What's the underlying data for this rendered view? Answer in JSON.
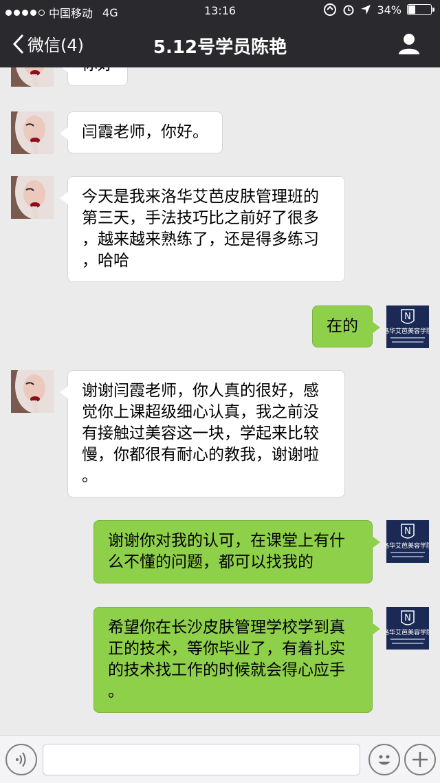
{
  "status_bar": {
    "carrier": "中国移动",
    "network": "4G",
    "time": "13:16",
    "battery": "34%",
    "battery_fraction": 0.34
  },
  "nav": {
    "back_label": "微信(4)",
    "title": "5.12号学员陈艳"
  },
  "messages": [
    {
      "side": "in",
      "text": "你好"
    },
    {
      "side": "in",
      "text": "闫霞老师，你好。"
    },
    {
      "side": "in",
      "lines": [
        "今天是我来洛华艾芭皮肤管理班的",
        "第三天，手法技巧比之前好了很多",
        "，越来越来熟练了，还是得多练习",
        "，哈哈"
      ]
    },
    {
      "side": "out",
      "text": "在的"
    },
    {
      "side": "in",
      "lines": [
        "谢谢闫霞老师，你人真的很好，感",
        "觉你上课超级细心认真，我之前没",
        "有接触过美容这一块，学起来比较",
        "慢，你都很有耐心的教我，谢谢啦",
        "。"
      ]
    },
    {
      "side": "out",
      "lines": [
        "谢谢你对我的认可，在课堂上有什",
        "么不懂的问题，都可以找我的"
      ]
    },
    {
      "side": "out",
      "lines": [
        "希望你在长沙皮肤管理学校学到真",
        "正的技术，等你毕业了，有着扎实",
        "的技术找工作的时候就会得心应手",
        "。"
      ]
    }
  ],
  "logo": {
    "letter": "N",
    "name": "洛华艾芭美容学院"
  },
  "colors": {
    "header_bg": "#2a2a2e",
    "chat_bg": "#ebebeb",
    "bubble_out": "#8fd04b",
    "bubble_in": "#ffffff"
  },
  "icons": [
    "voice-icon",
    "emoji-icon",
    "plus-icon",
    "person-icon",
    "back-chevron-icon"
  ]
}
